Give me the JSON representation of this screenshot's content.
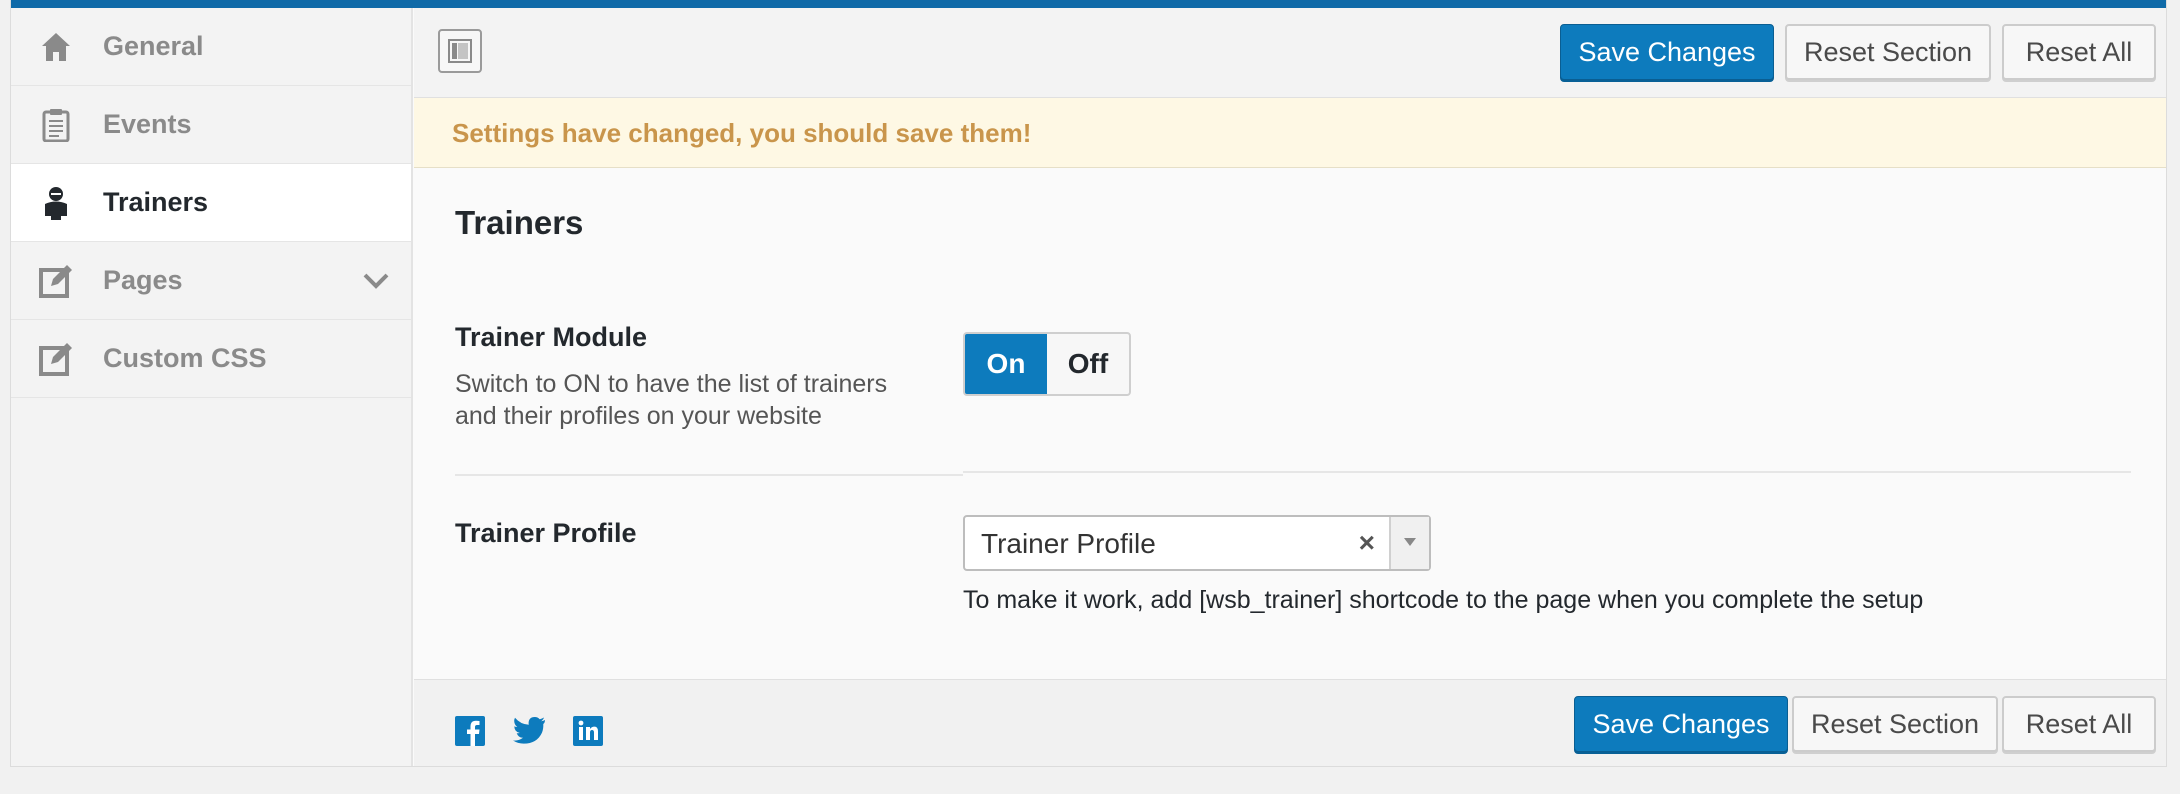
{
  "sidebar": {
    "items": [
      {
        "label": "General",
        "icon": "home-icon"
      },
      {
        "label": "Events",
        "icon": "clipboard-icon"
      },
      {
        "label": "Trainers",
        "icon": "person-icon",
        "active": true
      },
      {
        "label": "Pages",
        "icon": "edit-icon"
      },
      {
        "label": "Custom CSS",
        "icon": "edit-icon"
      }
    ]
  },
  "toolbar": {
    "save_label": "Save Changes",
    "reset_section_label": "Reset Section",
    "reset_all_label": "Reset All"
  },
  "notice": {
    "text": "Settings have changed, you should save them!"
  },
  "section": {
    "title": "Trainers",
    "trainer_module": {
      "label": "Trainer Module",
      "description": "Switch to ON to have the list of trainers and their profiles on your website",
      "on_label": "On",
      "off_label": "Off",
      "value": "On"
    },
    "trainer_profile": {
      "label": "Trainer Profile",
      "selected": "Trainer Profile",
      "clear_glyph": "×",
      "hint": "To make it work, add [wsb_trainer] shortcode to the page when you complete the setup"
    }
  },
  "footer": {
    "save_label": "Save Changes",
    "reset_section_label": "Reset Section",
    "reset_all_label": "Reset All",
    "social": [
      "facebook-icon",
      "twitter-icon",
      "linkedin-icon"
    ]
  },
  "colors": {
    "accent": "#0d7bbd",
    "top_bar": "#0f6aa8",
    "notice_bg": "#fef8e4",
    "notice_text": "#c9954b"
  }
}
